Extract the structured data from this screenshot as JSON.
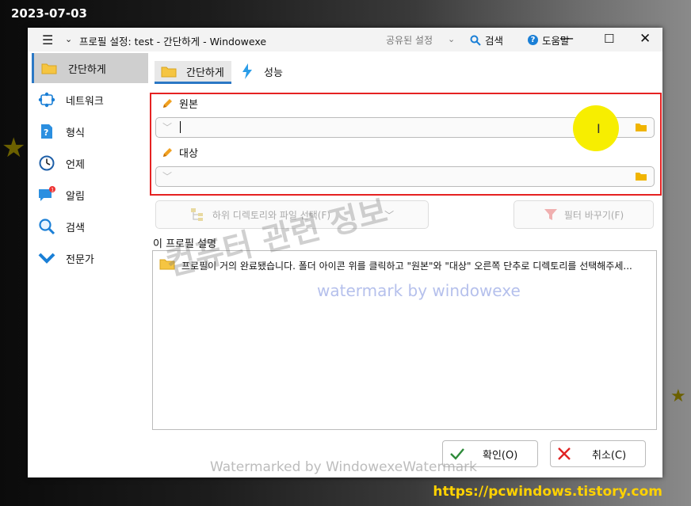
{
  "overlay": {
    "date": "2023-07-03",
    "site_url": "https://pcwindows.tistory.com",
    "watermark_ko": "컴퓨터 관련 정보",
    "watermark_en": "watermark by windowexe",
    "watermark_bottom": "Watermarked by WindowexeWatermark"
  },
  "titlebar": {
    "title": "프로필 설정: test - 간단하게  - Windowexe",
    "shared_settings": "공유된 설정",
    "search": "검색",
    "help": "도움말"
  },
  "sidebar": {
    "items": [
      {
        "label": "간단하게",
        "icon": "folder-icon",
        "active": true
      },
      {
        "label": "네트워크",
        "icon": "network-icon"
      },
      {
        "label": "형식",
        "icon": "format-icon"
      },
      {
        "label": "언제",
        "icon": "clock-icon"
      },
      {
        "label": "알림",
        "icon": "notification-icon"
      },
      {
        "label": "검색",
        "icon": "search-icon"
      },
      {
        "label": "전문가",
        "icon": "expert-chevron-icon"
      }
    ]
  },
  "tabs": {
    "simple": "간단하게",
    "performance": "성능"
  },
  "fields": {
    "source_label": "원본",
    "source_value": "",
    "target_label": "대상",
    "target_value": ""
  },
  "buttons": {
    "subdirs": "하위 디렉토리와 파일 선택(F)",
    "filter": "필터 바꾸기(F)",
    "ok": "확인(O)",
    "cancel": "취소(C)"
  },
  "description": {
    "label": "이 프로필 설명",
    "text": "프로필이 거의 완료됐습니다. 폴더 아이콘 위를 클릭하고 \"원본\"와 \"대상\" 오른쪽 단추로 디렉토리를 선택해주세..."
  },
  "colors": {
    "accent": "#2b78c5",
    "highlight_box": "#e52222",
    "cursor_spot": "#f7ee00",
    "url": "#ffd200"
  }
}
